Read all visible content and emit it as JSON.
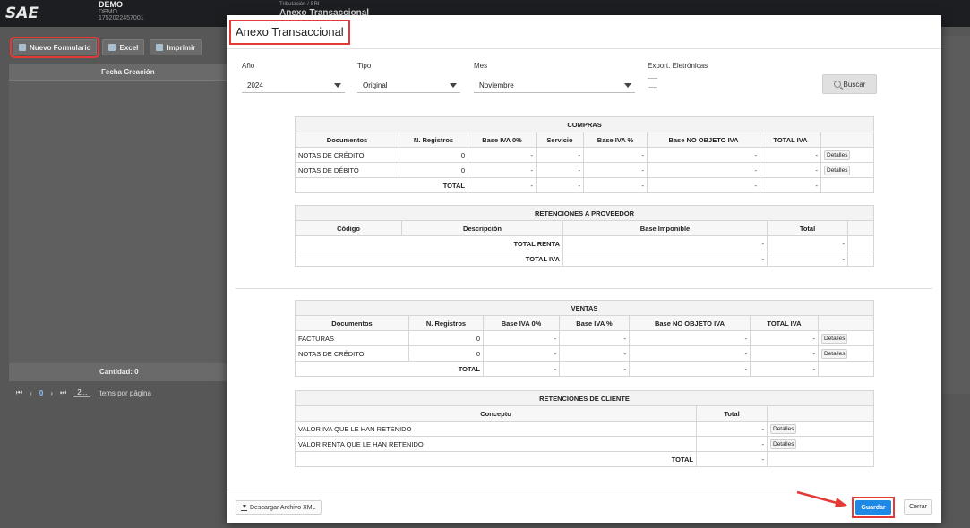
{
  "app": {
    "company_name": "DEMO",
    "company_sub": "DEMO",
    "company_id": "1752022457001",
    "breadcrumb": "Tributación / SRI",
    "page_title": "Anexo Transaccional",
    "accent_red": "#e53935",
    "accent_blue": "#1e88e5"
  },
  "background": {
    "toolbar": {
      "new_label": "Nuevo Formulario",
      "excel_label": "Excel",
      "print_label": "Imprimir"
    },
    "grid_header": "Fecha Creación",
    "grid_footer": "Cantidad: 0",
    "pager": {
      "first": "⏮",
      "prev": "‹",
      "page": "0",
      "next": "›",
      "last": "⏭",
      "page_size": "2...",
      "items_per_page": "Items por página"
    }
  },
  "modal": {
    "title": "Anexo Transaccional",
    "filters": {
      "year_label": "Año",
      "year_value": "2024",
      "type_label": "Tipo",
      "type_value": "Original",
      "month_label": "Mes",
      "month_value": "Noviembre",
      "export_label": "Export. Eletrónicas",
      "search_label": "Buscar"
    },
    "compras": {
      "title": "COMPRAS",
      "headers": [
        "Documentos",
        "N. Registros",
        "Base IVA 0%",
        "Servicio",
        "Base IVA %",
        "Base NO OBJETO IVA",
        "TOTAL IVA",
        ""
      ],
      "rows": [
        [
          "NOTAS DE CRÉDITO",
          "0",
          "-",
          "-",
          "-",
          "-",
          "-"
        ],
        [
          "NOTAS DE DÉBITO",
          "0",
          "-",
          "-",
          "-",
          "-",
          "-"
        ]
      ],
      "total_row": [
        "TOTAL",
        "-",
        "-",
        "-",
        "-",
        "-"
      ],
      "details_label": "Detalles"
    },
    "ret_proveedor": {
      "title": "RETENCIONES A PROVEEDOR",
      "headers": [
        "Código",
        "Descripción",
        "Base Imponible",
        "Total",
        ""
      ],
      "rows": [
        [
          "TOTAL RENTA",
          "-",
          "-"
        ],
        [
          "TOTAL IVA",
          "-",
          "-"
        ]
      ]
    },
    "ventas": {
      "title": "VENTAS",
      "headers": [
        "Documentos",
        "N. Registros",
        "Base IVA 0%",
        "Base IVA %",
        "Base NO OBJETO IVA",
        "TOTAL IVA",
        ""
      ],
      "rows": [
        [
          "FACTURAS",
          "0",
          "-",
          "-",
          "-",
          "-"
        ],
        [
          "NOTAS DE CRÉDITO",
          "0",
          "-",
          "-",
          "-",
          "-"
        ]
      ],
      "total_row": [
        "TOTAL",
        "-",
        "-",
        "-",
        "-"
      ],
      "details_label": "Detalles"
    },
    "ret_cliente": {
      "title": "RETENCIONES DE CLIENTE",
      "headers": [
        "Concepto",
        "Total",
        ""
      ],
      "rows": [
        [
          "VALOR IVA QUE LE HAN RETENIDO",
          "-"
        ],
        [
          "VALOR RENTA QUE LE HAN RETENIDO",
          "-"
        ]
      ],
      "total_row": [
        "TOTAL",
        "-"
      ],
      "details_label": "Detalles"
    },
    "footer": {
      "download_xml_label": "Descargar Archivo XML",
      "save_label": "Guardar",
      "close_label": "Cerrar"
    }
  }
}
